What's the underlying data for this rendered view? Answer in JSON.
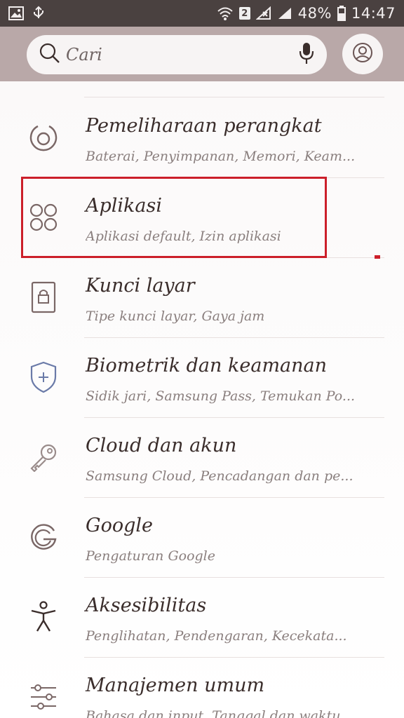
{
  "status_bar": {
    "battery_percent": "48%",
    "time": "14:47",
    "sim_slot": "2"
  },
  "search": {
    "placeholder": "Cari"
  },
  "settings_items": [
    {
      "title": "Pemeliharaan perangkat",
      "subtitle": "Baterai, Penyimpanan, Memori, Keam...",
      "icon": "device-care-icon"
    },
    {
      "title": "Aplikasi",
      "subtitle": "Aplikasi default, Izin aplikasi",
      "icon": "apps-icon"
    },
    {
      "title": "Kunci layar",
      "subtitle": "Tipe kunci layar, Gaya jam",
      "icon": "lock-screen-icon"
    },
    {
      "title": "Biometrik dan keamanan",
      "subtitle": "Sidik jari, Samsung Pass, Temukan Po...",
      "icon": "shield-icon"
    },
    {
      "title": "Cloud dan akun",
      "subtitle": "Samsung Cloud, Pencadangan dan pe...",
      "icon": "key-icon"
    },
    {
      "title": "Google",
      "subtitle": "Pengaturan Google",
      "icon": "google-icon"
    },
    {
      "title": "Aksesibilitas",
      "subtitle": "Penglihatan, Pendengaran, Kecekata...",
      "icon": "accessibility-icon"
    },
    {
      "title": "Manajemen umum",
      "subtitle": "Bahasa dan input, Tanggal dan waktu...",
      "icon": "sliders-icon"
    }
  ],
  "colors": {
    "status_bar_bg": "#4a4140",
    "header_bg": "#b9a8a8",
    "highlight": "#cc1f2a"
  }
}
